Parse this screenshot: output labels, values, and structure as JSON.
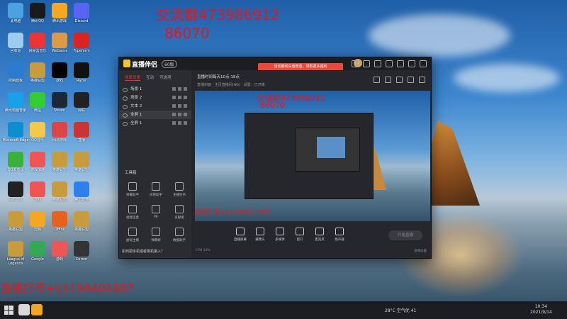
{
  "desktop": {
    "icons": [
      {
        "label": "此电脑",
        "color": "#4aa3df"
      },
      {
        "label": "腾讯QQ",
        "color": "#1a1a1a"
      },
      {
        "label": "腾讯游戏",
        "color": "#f5a623"
      },
      {
        "label": "Discord",
        "color": "#5865f2"
      },
      {
        "label": "回收站",
        "color": "#9ecbf0"
      },
      {
        "label": "网易云音乐",
        "color": "#e33"
      },
      {
        "label": "WeGame",
        "color": "#d94"
      },
      {
        "label": "Typeform",
        "color": "#d22"
      },
      {
        "label": "控制面板",
        "color": "#2b7bd1"
      },
      {
        "label": "英雄联盟",
        "color": "#c89b3c"
      },
      {
        "label": "游戏",
        "color": "#000"
      },
      {
        "label": "Razer",
        "color": "#111"
      },
      {
        "label": "腾讯电脑管家",
        "color": "#1aa0e8"
      },
      {
        "label": "微信",
        "color": "#3c3"
      },
      {
        "label": "Steam",
        "color": "#1b2838"
      },
      {
        "label": "绿联",
        "color": "#222"
      },
      {
        "label": "Microsoft Edge",
        "color": "#0c8fd0"
      },
      {
        "label": "QQ音乐",
        "color": "#f2c94c"
      },
      {
        "label": "网易游戏",
        "color": "#d44"
      },
      {
        "label": "直播",
        "color": "#c33"
      },
      {
        "label": "QQ浏览器",
        "color": "#3bb13b"
      },
      {
        "label": "游戏加速",
        "color": "#e55"
      },
      {
        "label": "英雄联盟",
        "color": "#c89b3c"
      },
      {
        "label": "英雄联盟",
        "color": "#c89b3c"
      },
      {
        "label": "Geforce",
        "color": "#222"
      },
      {
        "label": "游戏",
        "color": "#e55"
      },
      {
        "label": "英雄联盟",
        "color": "#c89b3c"
      },
      {
        "label": "腾讯安全",
        "color": "#2f80ed"
      },
      {
        "label": "英雄联盟",
        "color": "#c89b3c"
      },
      {
        "label": "剪辑",
        "color": "#f5a623"
      },
      {
        "label": "Office",
        "color": "#e8621e"
      },
      {
        "label": "英雄联盟",
        "color": "#c89b3c"
      },
      {
        "label": "League of Legends",
        "color": "#c89b3c"
      },
      {
        "label": "Google",
        "color": "#34a853"
      },
      {
        "label": "游戏",
        "color": "#e55"
      },
      {
        "label": "Cursor",
        "color": "#333"
      }
    ]
  },
  "overlay": {
    "group_line1": "交流群473986912",
    "group_line2": "86070",
    "live_inner1": "交流群473986912",
    "live_inner2": "86070",
    "ad_inner": "直播打号+q1196401887",
    "ad_bottom": "直播打号+q1196401887"
  },
  "window": {
    "app_name": "直播伴侣",
    "version": "60版",
    "promo": "活动期间充值赠送，领取更多福利",
    "tabs": [
      "场景设置",
      "互动",
      "可选项"
    ],
    "scenes": [
      {
        "label": "场景 1",
        "active": false
      },
      {
        "label": "场景 2",
        "active": false
      },
      {
        "label": "文本 2",
        "active": false
      },
      {
        "label": "全屏 1",
        "active": true
      },
      {
        "label": "全屏 1",
        "active": false
      }
    ],
    "toolbox_title": "工具箱",
    "tools": [
      "弹幕助手",
      "房管助手",
      "主播任务",
      "视频连麦",
      "PK",
      "贡献榜",
      "虚拟主播",
      "弹幕姬",
      "数据助手"
    ],
    "tip": "如何把手机或者相机接入？",
    "live_title": "直播时间每天10点-18点",
    "live_sub": "直播封面 · 主页直播间(AG) · 设置：已开播",
    "bottom_buttons": [
      "直播屏幕",
      "摄像头",
      "多媒体",
      "窗口",
      "麦克风",
      "扬声器"
    ],
    "start_button": "开始直播",
    "status_left": "CPU 12%",
    "status_right": "直播设置"
  },
  "taskbar": {
    "weather": "28°C 空气优 41",
    "time": "10:34",
    "date": "2021/9/14"
  }
}
